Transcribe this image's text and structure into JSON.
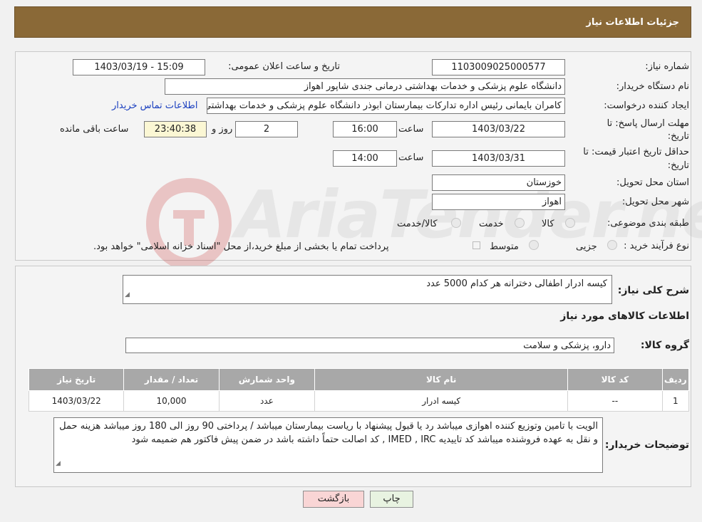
{
  "header": {
    "title": "جزئیات اطلاعات نیاز"
  },
  "need_number": {
    "label": "شماره نیاز:",
    "value": "1103009025000577"
  },
  "announce_datetime": {
    "label": "تاریخ و ساعت اعلان عمومی:",
    "value": "1403/03/19 - 15:09"
  },
  "buyer_org": {
    "label": "نام دستگاه خریدار:",
    "value": "دانشگاه علوم پزشکی و خدمات بهداشتی درمانی جندی شاپور اهواز"
  },
  "requester": {
    "label": "ایجاد کننده درخواست:",
    "value": "کامران بایمانی رئیس اداره تدارکات بیمارستان ابوذر  دانشگاه علوم پزشکی و خدمات بهداشتی درمانی جندی شاپور اهواز",
    "contact_link": "اطلاعات تماس خریدار"
  },
  "response_deadline": {
    "label_line1": "مهلت ارسال پاسخ: تا",
    "label_line2": "تاریخ:",
    "date": "1403/03/22",
    "time_label": "ساعت",
    "time": "16:00",
    "days": "2",
    "days_label": "روز و",
    "remaining": "23:40:38",
    "remaining_label": "ساعت باقی مانده"
  },
  "price_validity": {
    "label_line1": "حداقل تاریخ اعتبار قیمت: تا",
    "label_line2": "تاریخ:",
    "date": "1403/03/31",
    "time_label": "ساعت",
    "time": "14:00"
  },
  "delivery_province": {
    "label": "استان محل تحویل:",
    "value": "خوزستان"
  },
  "delivery_city": {
    "label": "شهر محل تحویل:",
    "value": "اهواز"
  },
  "category": {
    "label": "طبقه بندی موضوعی:",
    "options": [
      "کالا",
      "خدمت",
      "کالا/خدمت"
    ]
  },
  "purchase_process": {
    "label": "نوع فرآیند خرید :",
    "options": [
      "جزیی",
      "متوسط"
    ],
    "note": "پرداخت تمام یا بخشی از مبلغ خرید،از محل \"اسناد خزانه اسلامی\" خواهد بود."
  },
  "watermark": {
    "text": "AriaTender.neT"
  },
  "summary": {
    "label": "شرح کلی نیاز:",
    "value": "کیسه ادرار اطفالی دخترانه  هر کدام 5000 عدد"
  },
  "goods_info": {
    "title": "اطلاعات کالاهای مورد نیاز"
  },
  "goods_group": {
    "label": "گروه کالا:",
    "value": "دارو، پزشکی و سلامت"
  },
  "table": {
    "headers": [
      "ردیف",
      "کد کالا",
      "نام کالا",
      "واحد شمارش",
      "تعداد / مقدار",
      "تاریخ نیاز"
    ],
    "rows": [
      [
        "1",
        "--",
        "کیسه ادرار",
        "عدد",
        "10,000",
        "1403/03/22"
      ]
    ]
  },
  "buyer_notes": {
    "label": "توضیحات خریدار:",
    "value": "الویت با تامین وتوزیع کننده اهوازی  میباشد رد یا قبول پیشنهاد با ریاست بیمارستان میباشد / پرداختی 90 روز  الی 180 روز میباشد  هزینه حمل و نقل به عهده فروشنده میباشد   کد تاییدیه IMED , IRC , کد اصالت حتماً داشته باشد در ضمن پیش فاکتور هم ضمیمه شود"
  },
  "buttons": {
    "print": "چاپ",
    "back": "بازگشت"
  },
  "colors": {
    "header": "#8a6937",
    "table_header": "#a8a8a8",
    "back_button": "#f9d5d5",
    "print_button": "#e8f3e1"
  }
}
